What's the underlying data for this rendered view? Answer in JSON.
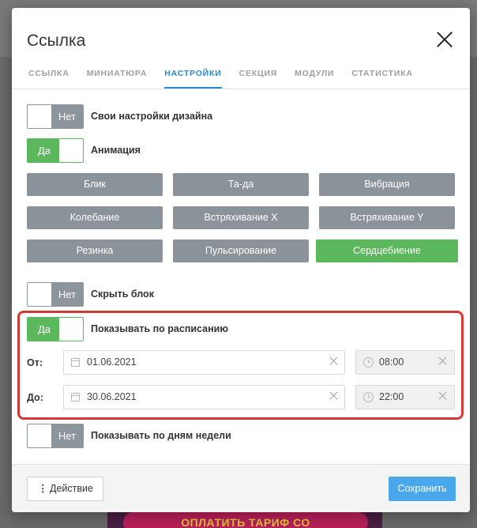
{
  "backdrop": {
    "promo_text": "ОПЛАТИТЬ ТАРИФ СО"
  },
  "modal": {
    "title": "Ссылка",
    "tabs": [
      {
        "label": "ССЫЛКА",
        "active": false
      },
      {
        "label": "МИНИАТЮРА",
        "active": false
      },
      {
        "label": "НАСТРОЙКИ",
        "active": true
      },
      {
        "label": "СЕКЦИЯ",
        "active": false
      },
      {
        "label": "МОДУЛИ",
        "active": false
      },
      {
        "label": "СТАТИСТИКА",
        "active": false
      }
    ]
  },
  "settings": {
    "design": {
      "label": "Свои настройки дизайна",
      "state_label": "Нет",
      "enabled": false
    },
    "animation": {
      "label": "Анимация",
      "state_label": "Да",
      "enabled": true,
      "options": [
        "Блик",
        "Та-да",
        "Вибрация",
        "Колебание",
        "Встряхивание X",
        "Встряхивание Y",
        "Резинка",
        "Пульсирование",
        "Сердцебиение"
      ],
      "selected": "Сердцебиение"
    },
    "hide_block": {
      "label": "Скрыть блок",
      "state_label": "Нет",
      "enabled": false
    },
    "schedule": {
      "label": "Показывать по расписанию",
      "state_label": "Да",
      "enabled": true,
      "from_label": "От:",
      "to_label": "До:",
      "from_date": "01.06.2021",
      "from_time": "08:00",
      "to_date": "30.06.2021",
      "to_time": "22:00"
    },
    "weekdays": {
      "label": "Показывать по дням недели",
      "state_label": "Нет",
      "enabled": false
    }
  },
  "footer": {
    "action_icon": "⋮",
    "action_label": "Действие",
    "save_label": "Сохранить"
  },
  "colors": {
    "accent": "#2a8ad8",
    "toggle_on": "#5cb85c",
    "toggle_off": "#8c959c",
    "highlight": "#d33a36",
    "save": "#4aa8ea"
  }
}
